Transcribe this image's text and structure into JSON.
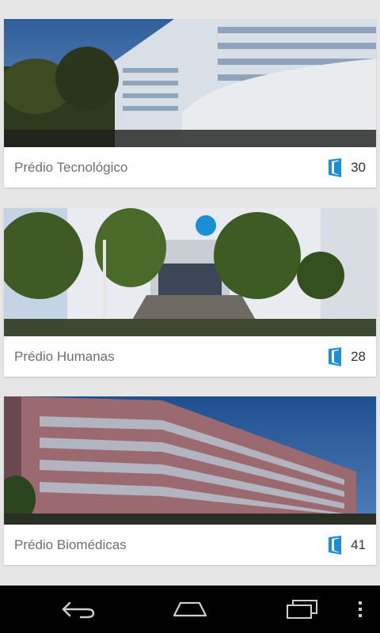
{
  "buildings": [
    {
      "name": "Prédio Tecnológico",
      "count": "30",
      "icon": "door-icon"
    },
    {
      "name": "Prédio Humanas",
      "count": "28",
      "icon": "door-icon"
    },
    {
      "name": "Prédio Biomédicas",
      "count": "41",
      "icon": "door-icon"
    }
  ],
  "navigation": {
    "back_icon": "back-arrow-icon",
    "home_icon": "home-icon",
    "recents_icon": "recent-apps-icon",
    "menu_icon": "overflow-menu-icon"
  },
  "colors": {
    "accent": "#1a8fd6",
    "background": "#e6e6e6",
    "card": "#ffffff",
    "navbar": "#000000"
  }
}
